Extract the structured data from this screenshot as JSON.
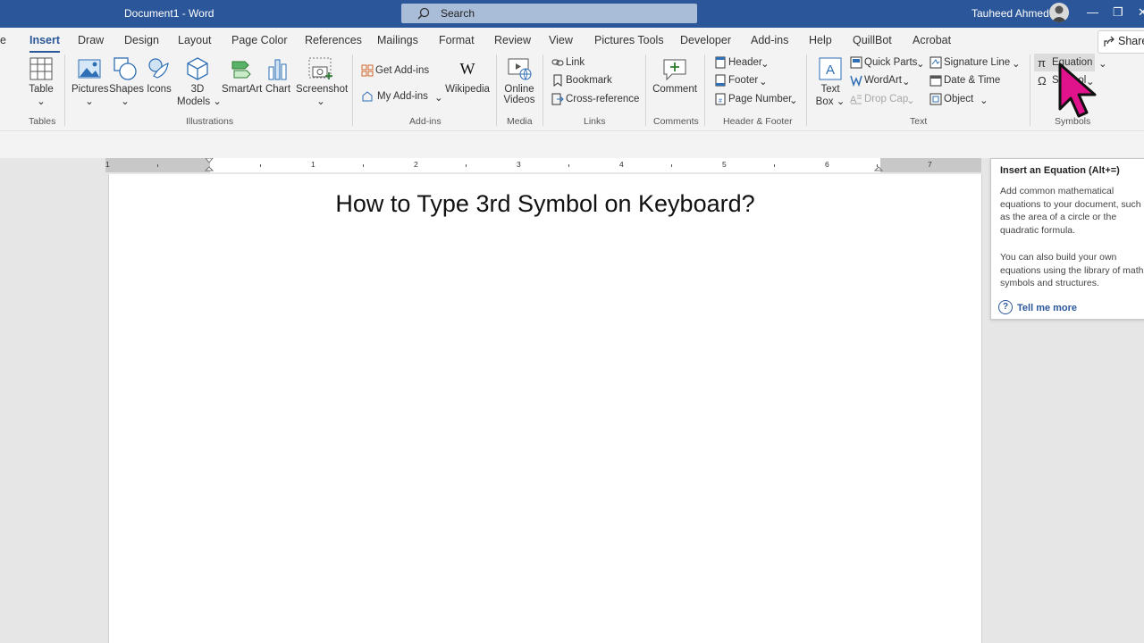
{
  "titlebar": {
    "doc_title": "Document1  -  Word",
    "search_placeholder": "Search",
    "user_name": "Tauheed Ahmed",
    "minimize": "—",
    "restore": "❐",
    "close": "✕"
  },
  "tabs": [
    "e",
    "Insert",
    "Draw",
    "Design",
    "Layout",
    "Page Color",
    "References",
    "Mailings",
    "Format",
    "Review",
    "View",
    "Pictures Tools",
    "Developer",
    "Add-ins",
    "Help",
    "QuillBot",
    "Acrobat"
  ],
  "active_tab": "Insert",
  "share_label": "Share",
  "groups": {
    "tables": {
      "label": "Tables",
      "table": "Table"
    },
    "illustrations": {
      "label": "Illustrations",
      "pictures": "Pictures",
      "shapes": "Shapes",
      "icons": "Icons",
      "models_1": "3D",
      "models_2": "Models",
      "smartart": "SmartArt",
      "chart": "Chart",
      "screenshot": "Screenshot"
    },
    "addins": {
      "label": "Add-ins",
      "get": "Get Add-ins",
      "my": "My Add-ins",
      "wikipedia": "Wikipedia"
    },
    "media": {
      "label": "Media",
      "online_1": "Online",
      "online_2": "Videos"
    },
    "links": {
      "label": "Links",
      "link": "Link",
      "bookmark": "Bookmark",
      "crossref": "Cross-reference"
    },
    "comments": {
      "label": "Comments",
      "comment": "Comment"
    },
    "header_footer": {
      "label": "Header & Footer",
      "header": "Header",
      "footer": "Footer",
      "page_number": "Page Number"
    },
    "text": {
      "label": "Text",
      "textbox_1": "Text",
      "textbox_2": "Box",
      "quick_parts": "Quick Parts",
      "wordart": "WordArt",
      "drop_cap": "Drop Cap",
      "signature": "Signature Line",
      "datetime": "Date & Time",
      "object": "Object"
    },
    "symbols": {
      "label": "Symbols",
      "equation": "Equation",
      "symbol": "Symbol"
    }
  },
  "ruler_numbers": [
    "1",
    "1",
    "2",
    "3",
    "4",
    "5",
    "6",
    "7"
  ],
  "document": {
    "heading": "How to Type 3rd Symbol on Keyboard?"
  },
  "tooltip": {
    "title": "Insert an Equation (Alt+=)",
    "para1": "Add common mathematical equations to your document, such as the area of a circle or the quadratic formula.",
    "para2": "You can also build your own equations using the library of math symbols and structures.",
    "tell_more": "Tell me more"
  },
  "colors": {
    "brand": "#2b579a",
    "cursor": "#e0138c"
  }
}
